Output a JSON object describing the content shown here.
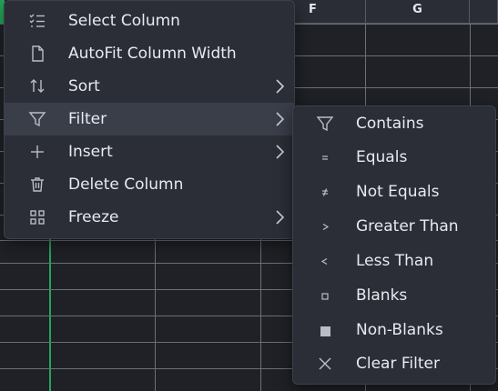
{
  "sheet": {
    "columns": [
      "F",
      "G"
    ]
  },
  "context_menu": {
    "items": [
      {
        "label": "Select Column",
        "icon": "select-list-icon",
        "has_submenu": false
      },
      {
        "label": "AutoFit Column Width",
        "icon": "document-icon",
        "has_submenu": false
      },
      {
        "label": "Sort",
        "icon": "sort-arrows-icon",
        "has_submenu": true
      },
      {
        "label": "Filter",
        "icon": "funnel-icon",
        "has_submenu": true
      },
      {
        "label": "Insert",
        "icon": "plus-icon",
        "has_submenu": true
      },
      {
        "label": "Delete Column",
        "icon": "trash-icon",
        "has_submenu": false
      },
      {
        "label": "Freeze",
        "icon": "grid-icon",
        "has_submenu": true
      }
    ],
    "active_item": "Filter"
  },
  "filter_submenu": {
    "items": [
      {
        "label": "Contains",
        "icon": "funnel-icon"
      },
      {
        "label": "Equals",
        "icon": "equals-icon"
      },
      {
        "label": "Not Equals",
        "icon": "not-equals-icon"
      },
      {
        "label": "Greater Than",
        "icon": "greater-than-icon"
      },
      {
        "label": "Less Than",
        "icon": "less-than-icon"
      },
      {
        "label": "Blanks",
        "icon": "empty-square-icon"
      },
      {
        "label": "Non-Blanks",
        "icon": "filled-square-icon"
      },
      {
        "label": "Clear Filter",
        "icon": "x-icon"
      }
    ]
  },
  "colors": {
    "menu_bg": "#2b2e36",
    "active_bg": "#3a3e49",
    "selection_green": "#22a65a",
    "text": "#e8eaf0"
  }
}
